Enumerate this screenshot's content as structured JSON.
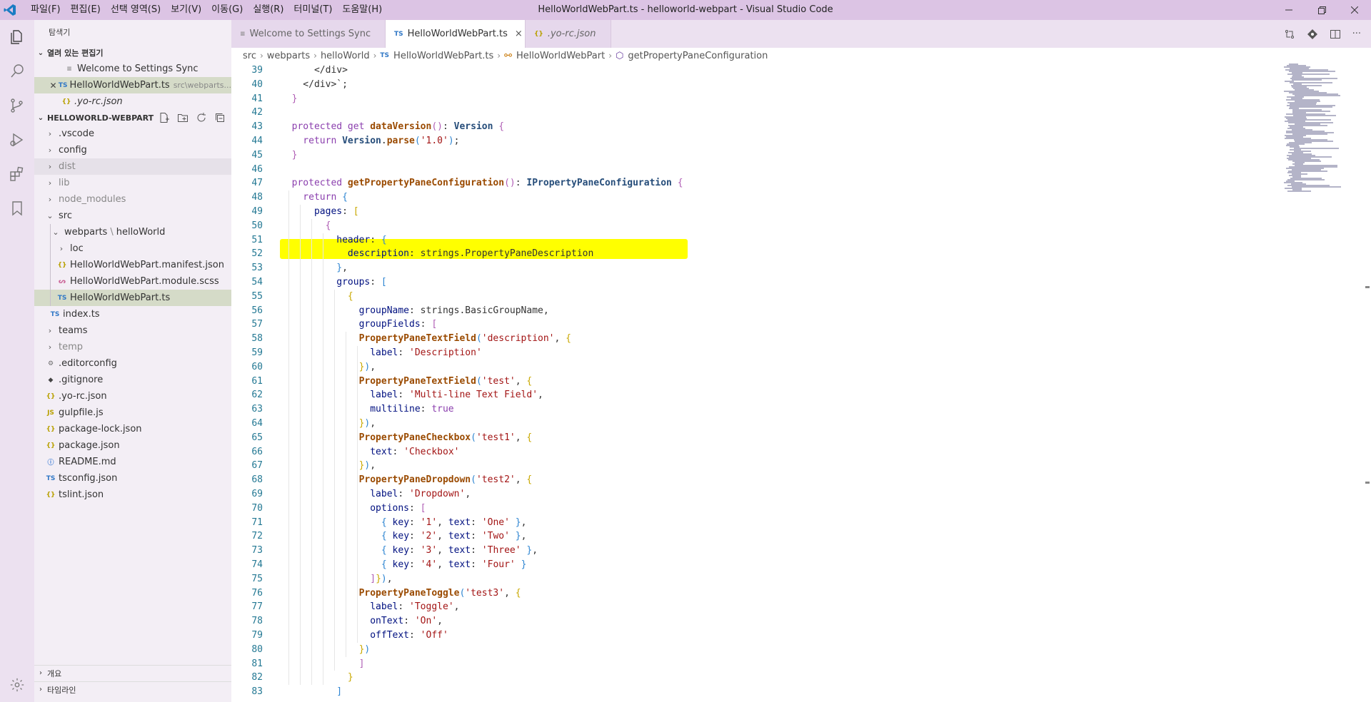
{
  "menu": [
    "파일(F)",
    "편집(E)",
    "선택 영역(S)",
    "보기(V)",
    "이동(G)",
    "실행(R)",
    "터미널(T)",
    "도움말(H)"
  ],
  "window_title": "HelloWorldWebPart.ts - helloworld-webpart - Visual Studio Code",
  "sidebar": {
    "title": "탐색기",
    "open_editors_title": "열려 있는 편집기",
    "open_editors": [
      {
        "icon": "doc",
        "label": "Welcome to Settings Sync"
      },
      {
        "icon": "TS",
        "label": "HelloWorldWebPart.ts",
        "desc": "src\\webparts..."
      },
      {
        "icon": "{}",
        "label": ".yo-rc.json"
      }
    ],
    "project_title": "HELLOWORLD-WEBPART",
    "tree": [
      {
        "label": ".vscode"
      },
      {
        "label": "config"
      },
      {
        "label": "dist"
      },
      {
        "label": "lib"
      },
      {
        "label": "node_modules"
      },
      {
        "label": "src"
      },
      {
        "label": "webparts",
        "sep": "\\",
        "label2": "helloWorld"
      },
      {
        "label": "loc"
      },
      {
        "icon": "{}",
        "label": "HelloWorldWebPart.manifest.json"
      },
      {
        "label": "HelloWorldWebPart.module.scss"
      },
      {
        "icon": "TS",
        "label": "HelloWorldWebPart.ts"
      },
      {
        "icon": "TS",
        "label": "index.ts"
      },
      {
        "label": "teams"
      },
      {
        "label": "temp"
      },
      {
        "label": ".editorconfig"
      },
      {
        "label": ".gitignore"
      },
      {
        "icon": "{}",
        "label": ".yo-rc.json"
      },
      {
        "icon": "JS",
        "label": "gulpfile.js"
      },
      {
        "icon": "{}",
        "label": "package-lock.json"
      },
      {
        "icon": "{}",
        "label": "package.json"
      },
      {
        "label": "README.md"
      },
      {
        "icon": "TS",
        "label": "tsconfig.json"
      },
      {
        "icon": "{}",
        "label": "tslint.json"
      }
    ],
    "outline_title": "개요",
    "timeline_title": "타임라인"
  },
  "tabs": [
    {
      "label": "Welcome to Settings Sync"
    },
    {
      "icon": "TS",
      "label": "HelloWorldWebPart.ts",
      "close": "×"
    },
    {
      "icon": "{}",
      "label": ".yo-rc.json"
    }
  ],
  "tab_actions_more": "···",
  "breadcrumb": [
    "src",
    "webparts",
    "helloWorld",
    "HelloWorldWebPart.ts",
    "HelloWorldWebPart",
    "getPropertyPaneConfiguration"
  ],
  "breadcrumb_sep": "›",
  "editor": {
    "line_numbers": [
      "39",
      "40",
      "41",
      "42",
      "43",
      "44",
      "45",
      "46",
      "47",
      "48",
      "49",
      "50",
      "51",
      "52",
      "53",
      "54",
      "55",
      "56",
      "57",
      "58",
      "59",
      "60",
      "61",
      "62",
      "63",
      "64",
      "65",
      "66",
      "67",
      "68",
      "69",
      "70",
      "71",
      "72",
      "73",
      "74",
      "75",
      "76",
      "77",
      "78",
      "79",
      "80",
      "81",
      "82",
      "83"
    ],
    "code": [
      [
        [
          "pu",
          "      </div>"
        ]
      ],
      [
        [
          "pu",
          "    </div>`;"
        ]
      ],
      [
        [
          "br2",
          "  }"
        ]
      ],
      [
        [
          "pu",
          ""
        ]
      ],
      [
        [
          "kw",
          "  protected get "
        ],
        [
          "fn",
          "dataVersion"
        ],
        [
          "br2",
          "()"
        ],
        [
          "pu",
          ": "
        ],
        [
          "ty",
          "Version"
        ],
        [
          "br2",
          " {"
        ]
      ],
      [
        [
          "kw",
          "    return "
        ],
        [
          "ty",
          "Version"
        ],
        [
          "pu",
          "."
        ],
        [
          "fn",
          "parse"
        ],
        [
          "br3",
          "("
        ],
        [
          "st",
          "'1.0'"
        ],
        [
          "br3",
          ")"
        ],
        [
          "pu",
          ";"
        ]
      ],
      [
        [
          "br2",
          "  }"
        ]
      ],
      [
        [
          "pu",
          ""
        ]
      ],
      [
        [
          "kw",
          "  protected "
        ],
        [
          "fn",
          "getPropertyPaneConfiguration"
        ],
        [
          "br2",
          "()"
        ],
        [
          "pu",
          ": "
        ],
        [
          "ty",
          "IPropertyPaneConfiguration"
        ],
        [
          "br2",
          " {"
        ]
      ],
      [
        [
          "kw",
          "    return "
        ],
        [
          "br3",
          "{"
        ]
      ],
      [
        [
          "pr",
          "      pages"
        ],
        [
          "pu",
          ": "
        ],
        [
          "br1",
          "["
        ]
      ],
      [
        [
          "br2",
          "        {"
        ]
      ],
      [
        [
          "pr",
          "          header"
        ],
        [
          "pu",
          ": "
        ],
        [
          "br3",
          "{"
        ]
      ],
      [
        [
          "pr",
          "            description"
        ],
        [
          "pu",
          ": strings.PropertyPaneDescription"
        ]
      ],
      [
        [
          "br3",
          "          }"
        ],
        [
          "pu",
          ","
        ]
      ],
      [
        [
          "pr",
          "          groups"
        ],
        [
          "pu",
          ": "
        ],
        [
          "br3",
          "["
        ]
      ],
      [
        [
          "br1",
          "            {"
        ]
      ],
      [
        [
          "pr",
          "              groupName"
        ],
        [
          "pu",
          ": strings.BasicGroupName,"
        ]
      ],
      [
        [
          "pr",
          "              groupFields"
        ],
        [
          "pu",
          ": "
        ],
        [
          "br2",
          "["
        ]
      ],
      [
        [
          "fn",
          "              PropertyPaneTextField"
        ],
        [
          "br3",
          "("
        ],
        [
          "st",
          "'description'"
        ],
        [
          "pu",
          ", "
        ],
        [
          "br1",
          "{"
        ]
      ],
      [
        [
          "pr",
          "                label"
        ],
        [
          "pu",
          ": "
        ],
        [
          "st",
          "'Description'"
        ]
      ],
      [
        [
          "br1",
          "              }"
        ],
        [
          "br3",
          ")"
        ],
        [
          "pu",
          ","
        ]
      ],
      [
        [
          "fn",
          "              PropertyPaneTextField"
        ],
        [
          "br3",
          "("
        ],
        [
          "st",
          "'test'"
        ],
        [
          "pu",
          ", "
        ],
        [
          "br1",
          "{"
        ]
      ],
      [
        [
          "pr",
          "                label"
        ],
        [
          "pu",
          ": "
        ],
        [
          "st",
          "'Multi-line Text Field'"
        ],
        [
          "pu",
          ","
        ]
      ],
      [
        [
          "pr",
          "                multiline"
        ],
        [
          "pu",
          ": "
        ],
        [
          "kw",
          "true"
        ]
      ],
      [
        [
          "br1",
          "              }"
        ],
        [
          "br3",
          ")"
        ],
        [
          "pu",
          ","
        ]
      ],
      [
        [
          "fn",
          "              PropertyPaneCheckbox"
        ],
        [
          "br3",
          "("
        ],
        [
          "st",
          "'test1'"
        ],
        [
          "pu",
          ", "
        ],
        [
          "br1",
          "{"
        ]
      ],
      [
        [
          "pr",
          "                text"
        ],
        [
          "pu",
          ": "
        ],
        [
          "st",
          "'Checkbox'"
        ]
      ],
      [
        [
          "br1",
          "              }"
        ],
        [
          "br3",
          ")"
        ],
        [
          "pu",
          ","
        ]
      ],
      [
        [
          "fn",
          "              PropertyPaneDropdown"
        ],
        [
          "br3",
          "("
        ],
        [
          "st",
          "'test2'"
        ],
        [
          "pu",
          ", "
        ],
        [
          "br1",
          "{"
        ]
      ],
      [
        [
          "pr",
          "                label"
        ],
        [
          "pu",
          ": "
        ],
        [
          "st",
          "'Dropdown'"
        ],
        [
          "pu",
          ","
        ]
      ],
      [
        [
          "pr",
          "                options"
        ],
        [
          "pu",
          ": "
        ],
        [
          "br2",
          "["
        ]
      ],
      [
        [
          "br3",
          "                  { "
        ],
        [
          "pr",
          "key"
        ],
        [
          "pu",
          ": "
        ],
        [
          "st",
          "'1'"
        ],
        [
          "pu",
          ", "
        ],
        [
          "pr",
          "text"
        ],
        [
          "pu",
          ": "
        ],
        [
          "st",
          "'One'"
        ],
        [
          "br3",
          " }"
        ],
        [
          "pu",
          ","
        ]
      ],
      [
        [
          "br3",
          "                  { "
        ],
        [
          "pr",
          "key"
        ],
        [
          "pu",
          ": "
        ],
        [
          "st",
          "'2'"
        ],
        [
          "pu",
          ", "
        ],
        [
          "pr",
          "text"
        ],
        [
          "pu",
          ": "
        ],
        [
          "st",
          "'Two'"
        ],
        [
          "br3",
          " }"
        ],
        [
          "pu",
          ","
        ]
      ],
      [
        [
          "br3",
          "                  { "
        ],
        [
          "pr",
          "key"
        ],
        [
          "pu",
          ": "
        ],
        [
          "st",
          "'3'"
        ],
        [
          "pu",
          ", "
        ],
        [
          "pr",
          "text"
        ],
        [
          "pu",
          ": "
        ],
        [
          "st",
          "'Three'"
        ],
        [
          "br3",
          " }"
        ],
        [
          "pu",
          ","
        ]
      ],
      [
        [
          "br3",
          "                  { "
        ],
        [
          "pr",
          "key"
        ],
        [
          "pu",
          ": "
        ],
        [
          "st",
          "'4'"
        ],
        [
          "pu",
          ", "
        ],
        [
          "pr",
          "text"
        ],
        [
          "pu",
          ": "
        ],
        [
          "st",
          "'Four'"
        ],
        [
          "br3",
          " }"
        ]
      ],
      [
        [
          "br2",
          "                ]"
        ],
        [
          "br1",
          "}"
        ],
        [
          "br3",
          ")"
        ],
        [
          "pu",
          ","
        ]
      ],
      [
        [
          "fn",
          "              PropertyPaneToggle"
        ],
        [
          "br3",
          "("
        ],
        [
          "st",
          "'test3'"
        ],
        [
          "pu",
          ", "
        ],
        [
          "br1",
          "{"
        ]
      ],
      [
        [
          "pr",
          "                label"
        ],
        [
          "pu",
          ": "
        ],
        [
          "st",
          "'Toggle'"
        ],
        [
          "pu",
          ","
        ]
      ],
      [
        [
          "pr",
          "                onText"
        ],
        [
          "pu",
          ": "
        ],
        [
          "st",
          "'On'"
        ],
        [
          "pu",
          ","
        ]
      ],
      [
        [
          "pr",
          "                offText"
        ],
        [
          "pu",
          ": "
        ],
        [
          "st",
          "'Off'"
        ]
      ],
      [
        [
          "br1",
          "              }"
        ],
        [
          "br3",
          ")"
        ]
      ],
      [
        [
          "br2",
          "              ]"
        ]
      ],
      [
        [
          "br1",
          "            }"
        ]
      ],
      [
        [
          "br3",
          "          ]"
        ]
      ]
    ]
  },
  "colors": {
    "titlebar": "#dcc4e4",
    "activitybar": "#ece1f0",
    "sidebar": "#f3eef5",
    "highlight": "#ffff00",
    "selected_row": "#d5dbc8"
  }
}
